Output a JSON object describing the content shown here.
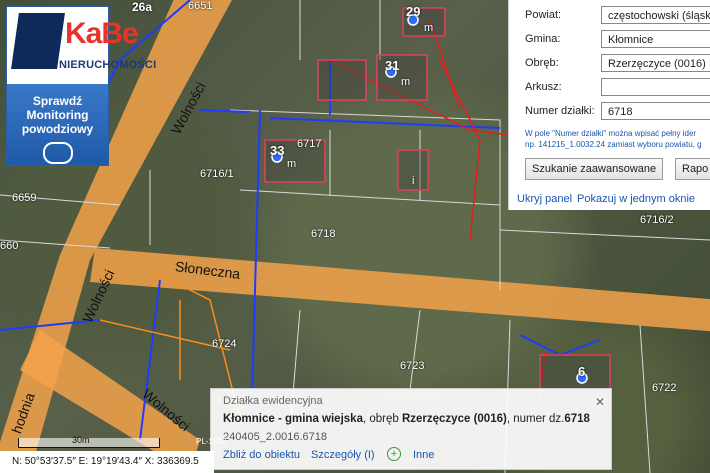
{
  "logo": {
    "brand": "KaBe",
    "subtitle": "NIERUCHOMOŚCI",
    "button_line1": "Sprawdź",
    "button_line2": "Monitoring",
    "button_line3": "powodziowy",
    "url_fragment": "mapa.net"
  },
  "form": {
    "powiat_label": "Powiat:",
    "powiat_value": "częstochowski (śląsk",
    "gmina_label": "Gmina:",
    "gmina_value": "Kłomnice",
    "obreb_label": "Obręb:",
    "obreb_value": "Rzerzęczyce (0016)",
    "arkusz_label": "Arkusz:",
    "arkusz_value": "",
    "numer_label": "Numer działki:",
    "numer_value": "6718",
    "hint_line1": "W pole \"Numer działki\" można wpisać pełny ider",
    "hint_line2": "np. 141215_1.0032.24 zamiast wyboru powiatu, g",
    "advanced_button": "Szukanie zaawansowane",
    "report_button": "Rapo",
    "hide_panel": "Ukryj panel",
    "show_one_window": "Pokazuj w jednym oknie"
  },
  "info": {
    "heading": "Działka ewidencyjna",
    "gmina": "Kłomnice - gmina wiejska",
    "obreb_prefix": ", obręb ",
    "obreb": "Rzerzęczyce (0016)",
    "numer_prefix": ", numer dz.",
    "numer": "6718",
    "identifier": "240405_2.0016.6718",
    "zoom_link": "Zbliż do obiektu",
    "details_link": "Szczegóły (I)",
    "other_link": "Inne"
  },
  "status": {
    "coords": "N: 50°53′37.5″  E: 19°19′43.4″  X: 336369.5",
    "scale_label": "30m",
    "pl_label": "PL-1992"
  },
  "map_labels": {
    "streets": [
      "Wolności",
      "Wolności",
      "Wolności",
      "Słoneczna",
      "Wolności",
      "hodnia"
    ],
    "parcels": [
      "6651",
      "6717",
      "6716/1",
      "6718",
      "6716/2",
      "6659",
      "660",
      "6724",
      "6723",
      "6722",
      "26a"
    ],
    "house_numbers": [
      "29",
      "31",
      "33",
      "6"
    ],
    "marker_m": "m",
    "marker_i": "i"
  },
  "colors": {
    "road": "#f3a24a",
    "parcel_line": "#d9d9d9",
    "utility_blue": "#1e3cff",
    "utility_red": "#e02020",
    "building_outline": "#e0405a",
    "panel_link": "#1a56b0"
  }
}
